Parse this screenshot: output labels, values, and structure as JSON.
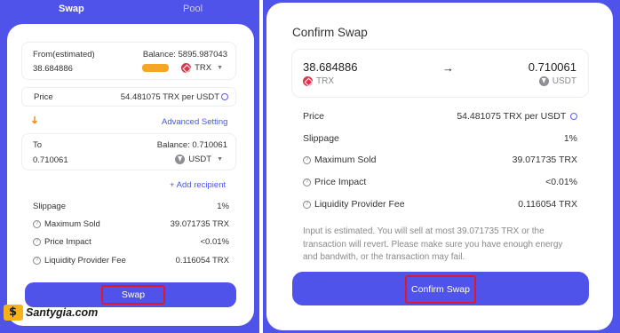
{
  "left": {
    "tabs": [
      {
        "label": "Swap",
        "active": true
      },
      {
        "label": "Pool",
        "active": false
      }
    ],
    "from": {
      "label": "From(estimated)",
      "balance": "Balance: 5895.987043",
      "amount": "38.684886",
      "token": "TRX"
    },
    "price": {
      "label": "Price",
      "value": "54.481075 TRX per USDT"
    },
    "advanced_setting": "Advanced Setting",
    "to": {
      "label": "To",
      "balance": "Balance: 0.710061",
      "amount": "0.710061",
      "token": "USDT"
    },
    "add_recipient": "+ Add recipient",
    "details": [
      {
        "label": "Slippage",
        "value": "1%",
        "info": false
      },
      {
        "label": "Maximum Sold",
        "value": "39.071735 TRX",
        "info": true
      },
      {
        "label": "Price Impact",
        "value": "<0.01%",
        "info": true
      },
      {
        "label": "Liquidity Provider Fee",
        "value": "0.116054 TRX",
        "info": true
      }
    ],
    "swap_button": "Swap"
  },
  "logo_text": "Santygia.com",
  "right": {
    "title": "Confirm Swap",
    "from_amount": "38.684886",
    "from_token": "TRX",
    "to_amount": "0.710061",
    "to_token": "USDT",
    "details": [
      {
        "label": "Price",
        "value": "54.481075 TRX per USDT",
        "info": false
      },
      {
        "label": "Slippage",
        "value": "1%",
        "info": false
      },
      {
        "label": "Maximum Sold",
        "value": "39.071735 TRX",
        "info": true
      },
      {
        "label": "Price Impact",
        "value": "<0.01%",
        "info": true
      },
      {
        "label": "Liquidity Provider Fee",
        "value": "0.116054 TRX",
        "info": true
      }
    ],
    "notice": "Input is estimated. You will sell at most 39.071735 TRX or the transaction will revert. Please make sure you have enough energy and bandwith, or the transaction may fail.",
    "confirm_button": "Confirm Swap"
  },
  "colors": {
    "primary": "#4f53ea",
    "link": "#4a56e6",
    "highlight_box": "#e0182d",
    "trx": "#d23b4e"
  }
}
